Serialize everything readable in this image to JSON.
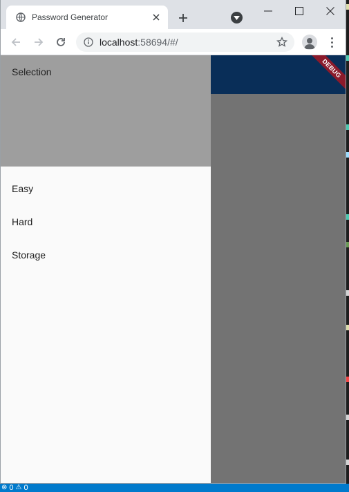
{
  "browser": {
    "tab_title": "Password Generator",
    "url_host": "localhost",
    "url_path": ":58694/#/"
  },
  "drawer": {
    "header": "Selection",
    "items": [
      {
        "label": "Easy"
      },
      {
        "label": "Hard"
      },
      {
        "label": "Storage"
      }
    ]
  },
  "debug_banner": "DEBUG",
  "status_bar": {
    "errors": "0",
    "warnings": "0"
  },
  "colors": {
    "app_bar": "#1565c0",
    "drawer_header": "#9e9e9e",
    "status_bar": "#007acc",
    "debug_banner": "#8b1a2b"
  }
}
